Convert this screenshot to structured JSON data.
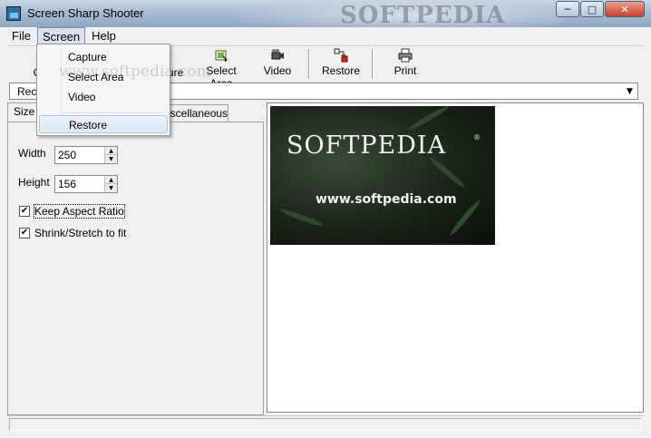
{
  "window": {
    "title": "Screen Sharp Shooter",
    "title_background_text": "SOFTPEDIA",
    "buttons": {
      "minimize": "─",
      "maximize": "□",
      "close": "✕"
    }
  },
  "menubar": {
    "file": "File",
    "screen": "Screen",
    "help": "Help"
  },
  "toolbar": {
    "capture_partial": "C",
    "capture2_partial": "ture",
    "select_area": "Select Area",
    "video": "Video",
    "restore": "Restore",
    "print": "Print"
  },
  "combo": {
    "value_partial": "Rec",
    "arrow": "▼"
  },
  "tabs": {
    "size": "Size",
    "miscellaneous_partial": "iscellaneous"
  },
  "size_panel": {
    "width_label": "Width",
    "width_value": "250",
    "height_label": "Height",
    "height_value": "156",
    "keep_aspect": "Keep Aspect Ratio",
    "keep_aspect_checked": "✔",
    "shrink_stretch": "Shrink/Stretch to fit",
    "shrink_stretch_checked": "✔",
    "spin_up": "▲",
    "spin_down": "▼"
  },
  "preview": {
    "logo": "SOFTPEDIA",
    "registered": "®",
    "url": "www.softpedia.com"
  },
  "dropdown": {
    "items": [
      "Capture",
      "Select Area",
      "Video",
      "Restore"
    ],
    "ghost_text": "www.softpedia.com"
  },
  "colors": {
    "titlebar": "#a9bcd2",
    "close_button": "#c7402a",
    "highlight": "#dbe8f6"
  }
}
